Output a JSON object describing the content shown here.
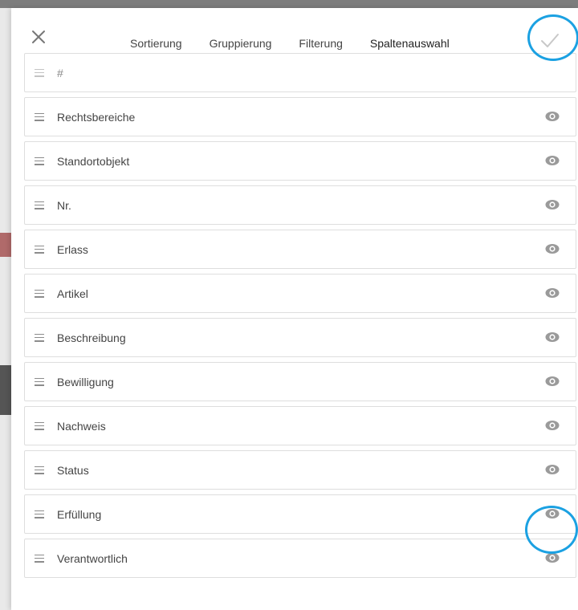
{
  "close_icon": "close-icon",
  "confirm_icon": "check-icon",
  "tabs": [
    {
      "label": "Sortierung",
      "active": false
    },
    {
      "label": "Gruppierung",
      "active": false
    },
    {
      "label": "Filterung",
      "active": false
    },
    {
      "label": "Spaltenauswahl",
      "active": true
    }
  ],
  "columns": [
    {
      "label": "#",
      "visibility_toggle": false
    },
    {
      "label": "Rechtsbereiche",
      "visibility_toggle": true
    },
    {
      "label": "Standortobjekt",
      "visibility_toggle": true
    },
    {
      "label": "Nr.",
      "visibility_toggle": true
    },
    {
      "label": "Erlass",
      "visibility_toggle": true
    },
    {
      "label": "Artikel",
      "visibility_toggle": true
    },
    {
      "label": "Beschreibung",
      "visibility_toggle": true
    },
    {
      "label": "Bewilligung",
      "visibility_toggle": true
    },
    {
      "label": "Nachweis",
      "visibility_toggle": true
    },
    {
      "label": "Status",
      "visibility_toggle": true
    },
    {
      "label": "Erfüllung",
      "visibility_toggle": true
    },
    {
      "label": "Verantwortlich",
      "visibility_toggle": true
    }
  ],
  "colors": {
    "active_tab_underline": "#c0234a",
    "highlight_circle": "#1ba1e2",
    "icon_gray": "#9a9a9a"
  }
}
